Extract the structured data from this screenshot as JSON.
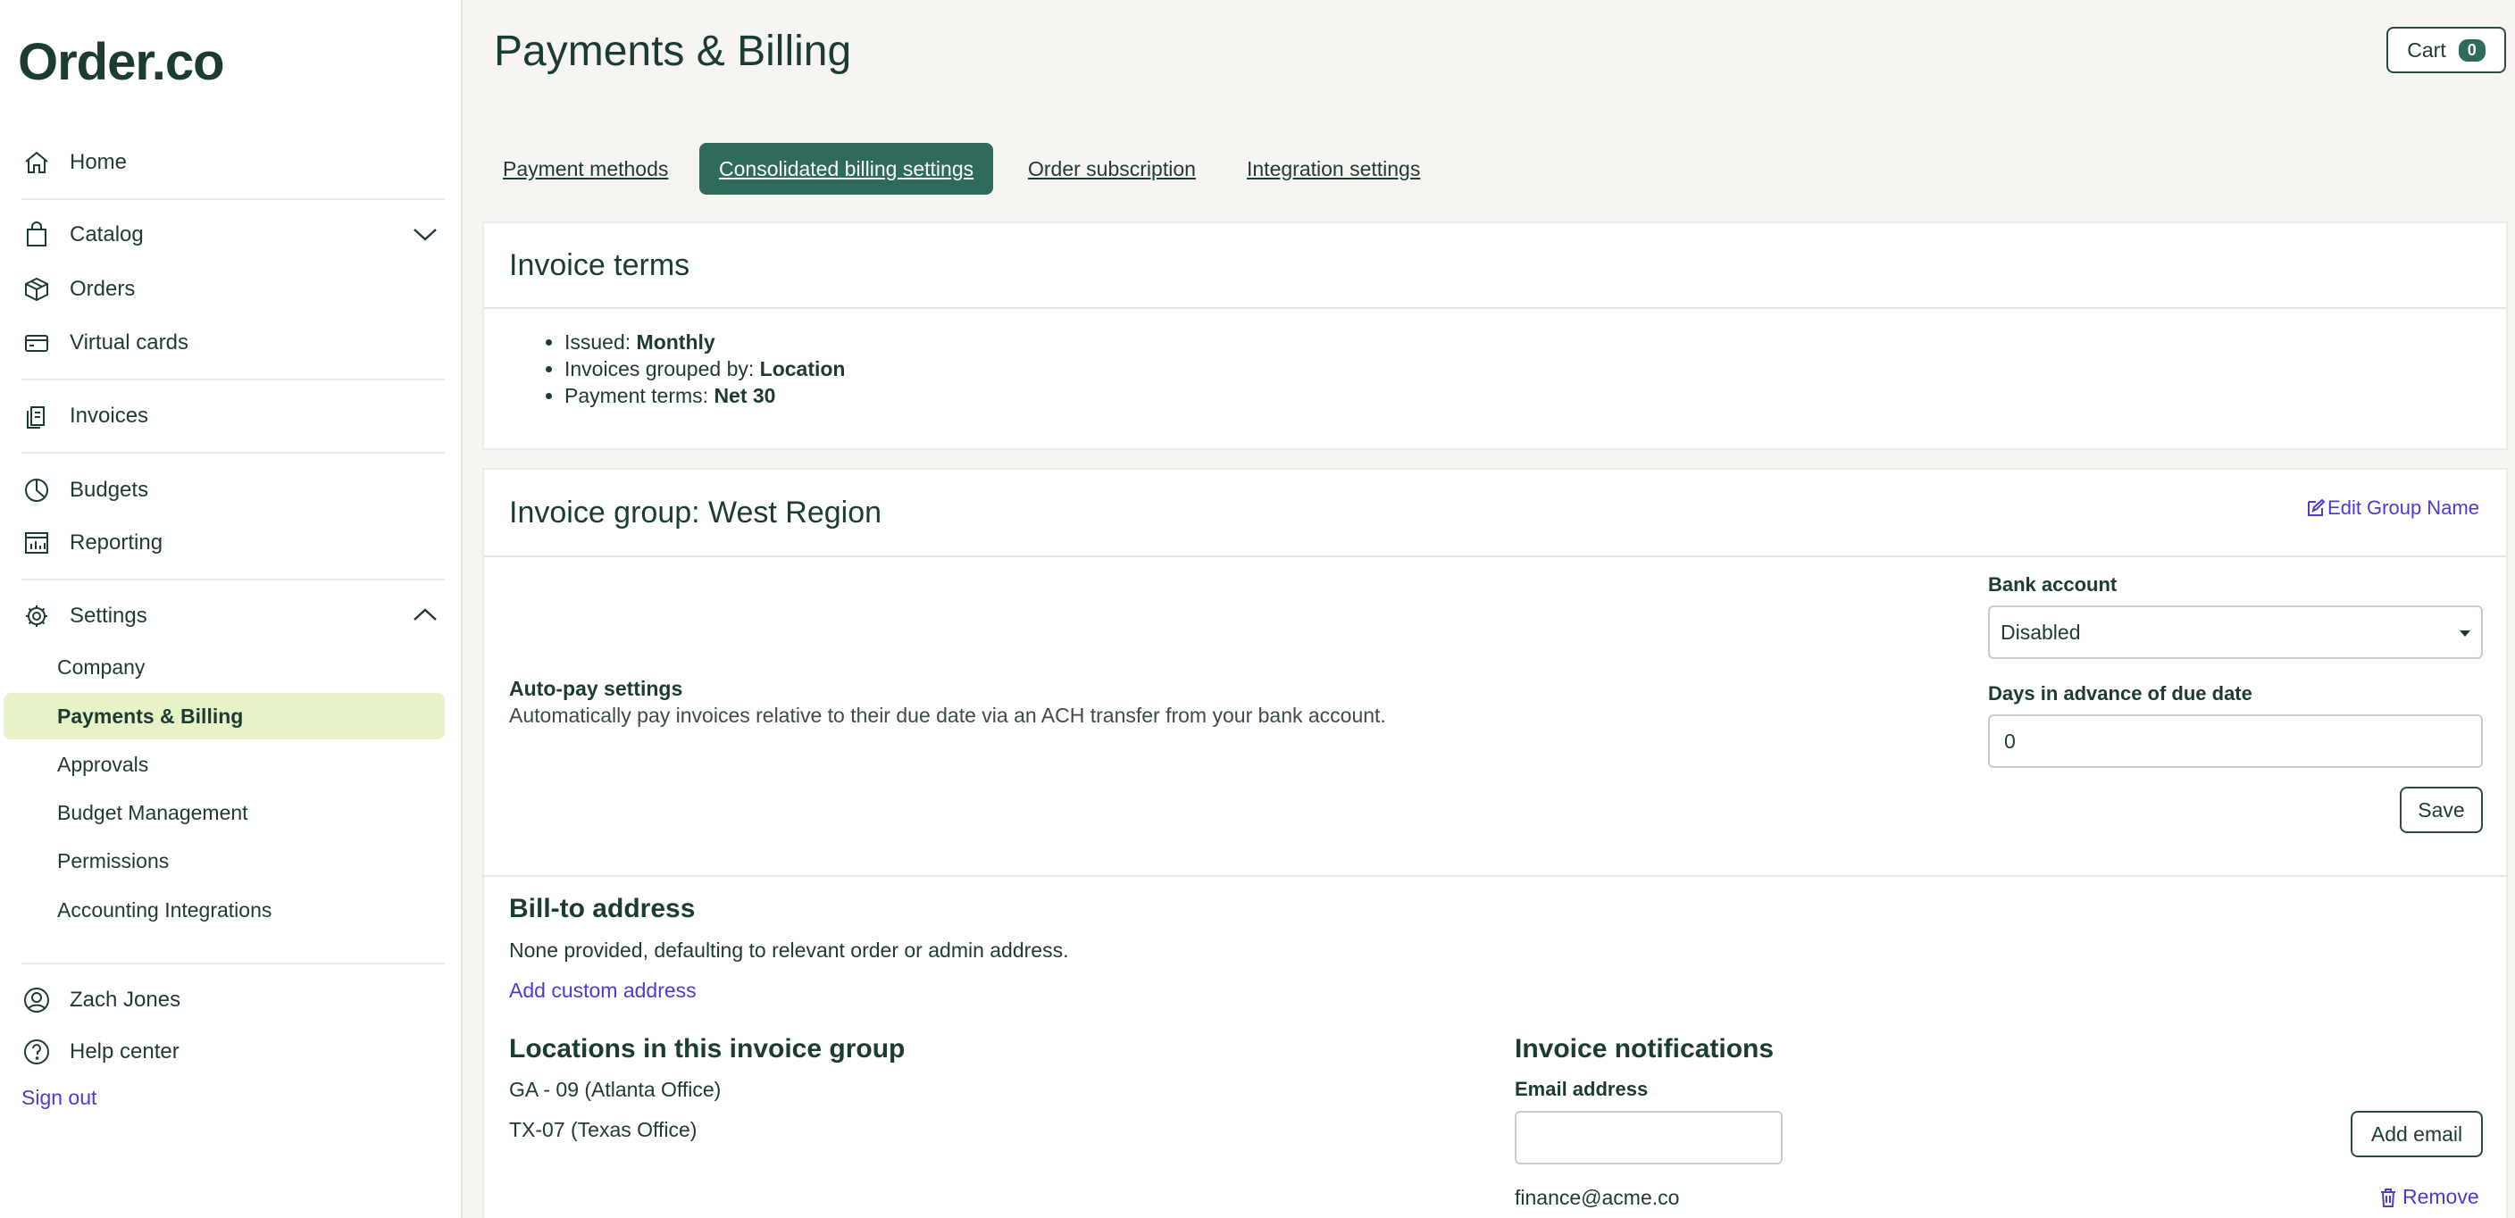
{
  "brand": {
    "logo": "Order.co"
  },
  "sidebar": {
    "items": [
      {
        "label": "Home",
        "icon": "home-icon"
      },
      {
        "label": "Catalog",
        "icon": "bag-icon"
      },
      {
        "label": "Orders",
        "icon": "box-icon"
      },
      {
        "label": "Virtual cards",
        "icon": "card-icon"
      },
      {
        "label": "Invoices",
        "icon": "invoice-icon"
      },
      {
        "label": "Budgets",
        "icon": "pie-icon"
      },
      {
        "label": "Reporting",
        "icon": "report-icon"
      },
      {
        "label": "Settings",
        "icon": "gear-icon"
      }
    ],
    "settings_sub": [
      {
        "label": "Company"
      },
      {
        "label": "Payments & Billing",
        "active": true
      },
      {
        "label": "Approvals"
      },
      {
        "label": "Budget Management"
      },
      {
        "label": "Permissions"
      },
      {
        "label": "Accounting Integrations"
      }
    ],
    "user": "Zach Jones",
    "help": "Help center",
    "signout": "Sign out"
  },
  "header": {
    "title": "Payments & Billing",
    "cart_label": "Cart",
    "cart_count": "0"
  },
  "tabs": [
    {
      "label": "Payment methods"
    },
    {
      "label": "Consolidated billing settings",
      "active": true
    },
    {
      "label": "Order subscription"
    },
    {
      "label": "Integration settings"
    }
  ],
  "invoice_terms": {
    "title": "Invoice terms",
    "issued_label": "Issued: ",
    "issued_value": "Monthly",
    "grouped_label": "Invoices grouped by: ",
    "grouped_value": "Location",
    "payment_label": "Payment terms: ",
    "payment_value": "Net 30"
  },
  "invoice_group": {
    "title": "Invoice group: West Region",
    "edit_label": "Edit Group Name",
    "autopay_title": "Auto-pay settings",
    "autopay_desc": "Automatically pay invoices relative to their due date via an ACH transfer from your bank account.",
    "bank_label": "Bank account",
    "bank_value": "Disabled",
    "days_label": "Days in advance of due date",
    "days_value": "0",
    "save_label": "Save",
    "billto_title": "Bill-to address",
    "billto_desc": "None provided, defaulting to relevant order or admin address.",
    "add_address": "Add custom address",
    "locations_title": "Locations in this invoice group",
    "locations": [
      "GA - 09 (Atlanta Office)",
      "TX-07 (Texas Office)"
    ],
    "notif_title": "Invoice notifications",
    "email_label": "Email address",
    "email_value": "",
    "add_email": "Add email",
    "emails": [
      "finance@acme.co"
    ],
    "remove_label": "Remove"
  },
  "colors": {
    "accent": "#2f6b5a",
    "link": "#4a3bd6",
    "active_bg": "#e7f2c7"
  }
}
